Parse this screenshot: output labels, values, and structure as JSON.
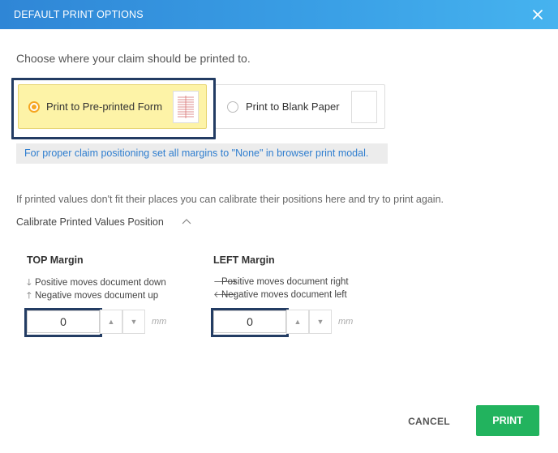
{
  "dialog": {
    "title": "DEFAULT PRINT OPTIONS",
    "subtitle": "Choose where your claim should be printed to.",
    "close_icon": "close-icon"
  },
  "print_targets": [
    {
      "label": "Print to Pre-printed Form",
      "selected": true
    },
    {
      "label": "Print to Blank Paper",
      "selected": false
    }
  ],
  "info": "For proper claim positioning set all margins to \"None\" in browser print  modal.",
  "calibration": {
    "description": "If printed values don't fit their places you can calibrate their positions here and try to print again.",
    "toggle_label": "Calibrate Printed Values Position",
    "toggle_icon": "chevron-up-icon"
  },
  "top_margin": {
    "title": "TOP Margin",
    "hint_positive": "Positive moves document down",
    "hint_negative": "Negative moves document up",
    "value": "0",
    "unit": "mm"
  },
  "left_margin": {
    "title": "LEFT Margin",
    "hint_positive": "Positive moves document right",
    "hint_negative": "Negative moves document left",
    "value": "0",
    "unit": "mm"
  },
  "actions": {
    "cancel": "CANCEL",
    "print": "PRINT"
  },
  "colors": {
    "header": "#3aa0e6",
    "selected_bg": "#fdf3a7",
    "radio_accent": "#f5a623",
    "info_text": "#2f7ecf",
    "print_button": "#22b35e",
    "highlight_outline": "#233c63"
  }
}
